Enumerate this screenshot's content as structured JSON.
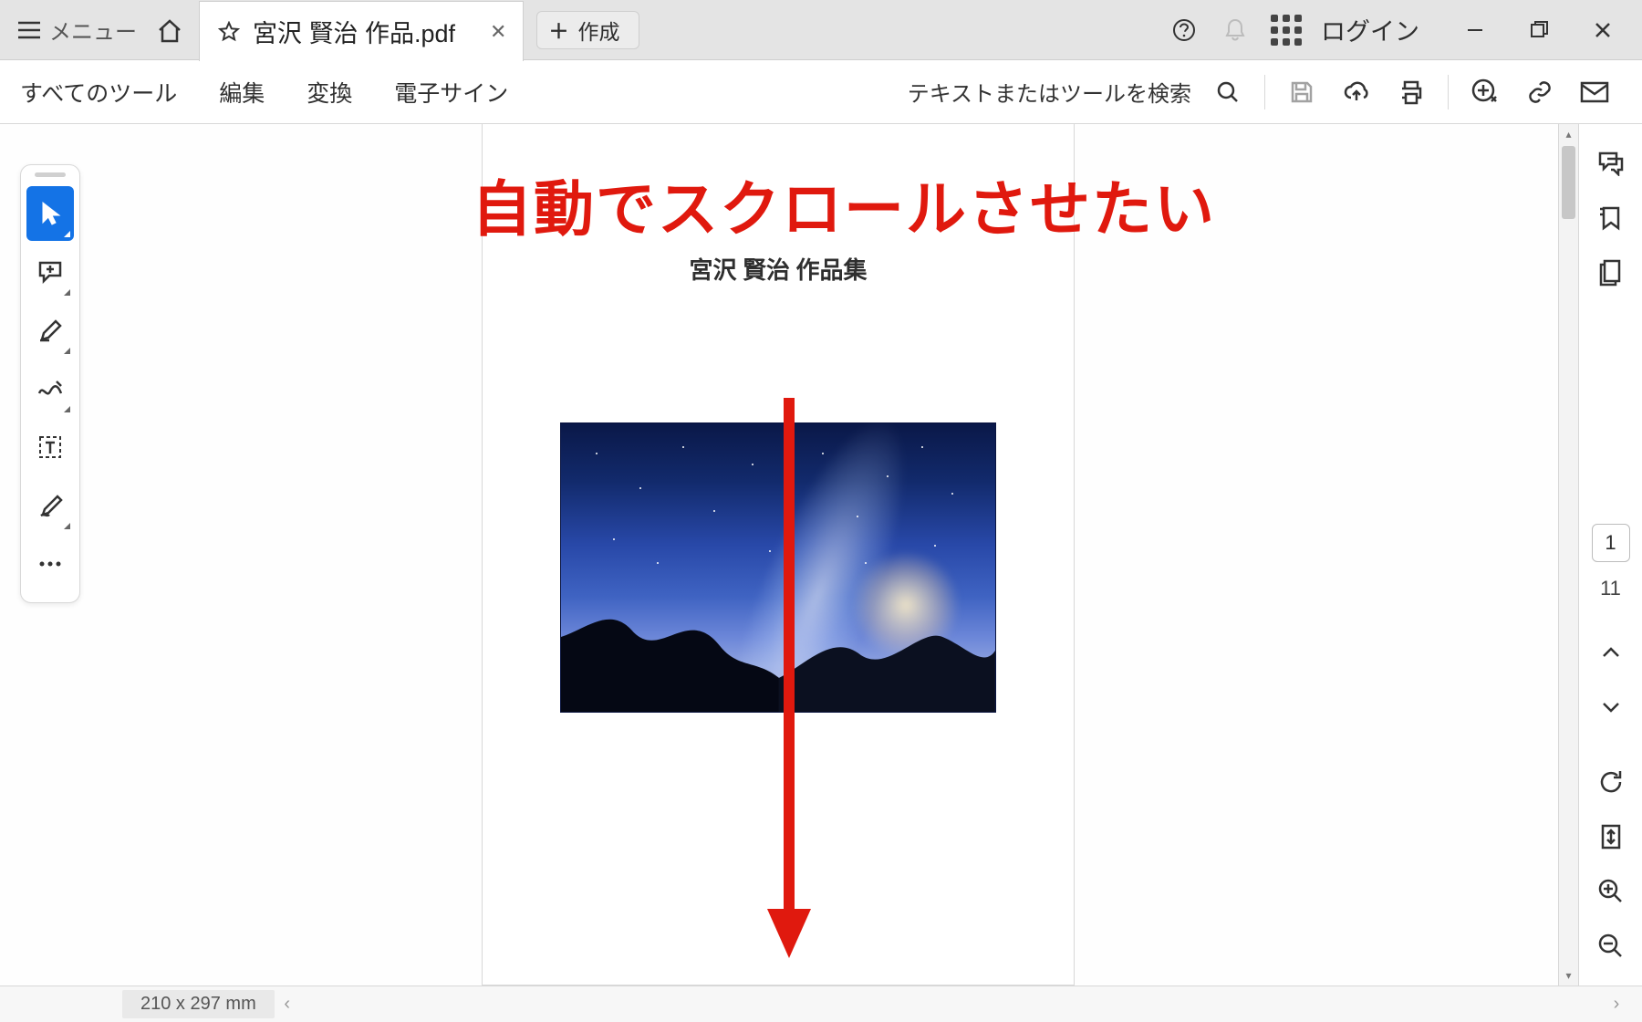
{
  "title_bar": {
    "menu_label": "メニュー",
    "tab_name": "宮沢 賢治 作品.pdf",
    "new_tab_label": "作成",
    "login_label": "ログイン"
  },
  "toolbar": {
    "all_tools": "すべてのツール",
    "edit": "編集",
    "convert": "変換",
    "esign": "電子サイン",
    "search_placeholder": "テキストまたはツールを検索"
  },
  "float_tools": {
    "items": [
      "select",
      "comment",
      "highlight",
      "draw",
      "textbox",
      "sign",
      "more"
    ]
  },
  "right_panel": {
    "current_page": "1",
    "total_pages": "11"
  },
  "document": {
    "page_heading": "宮沢 賢治  作品集"
  },
  "annotation": {
    "text": "自動でスクロールさせたい",
    "color": "#e0190e"
  },
  "status": {
    "dimensions": "210 x 297 mm"
  }
}
